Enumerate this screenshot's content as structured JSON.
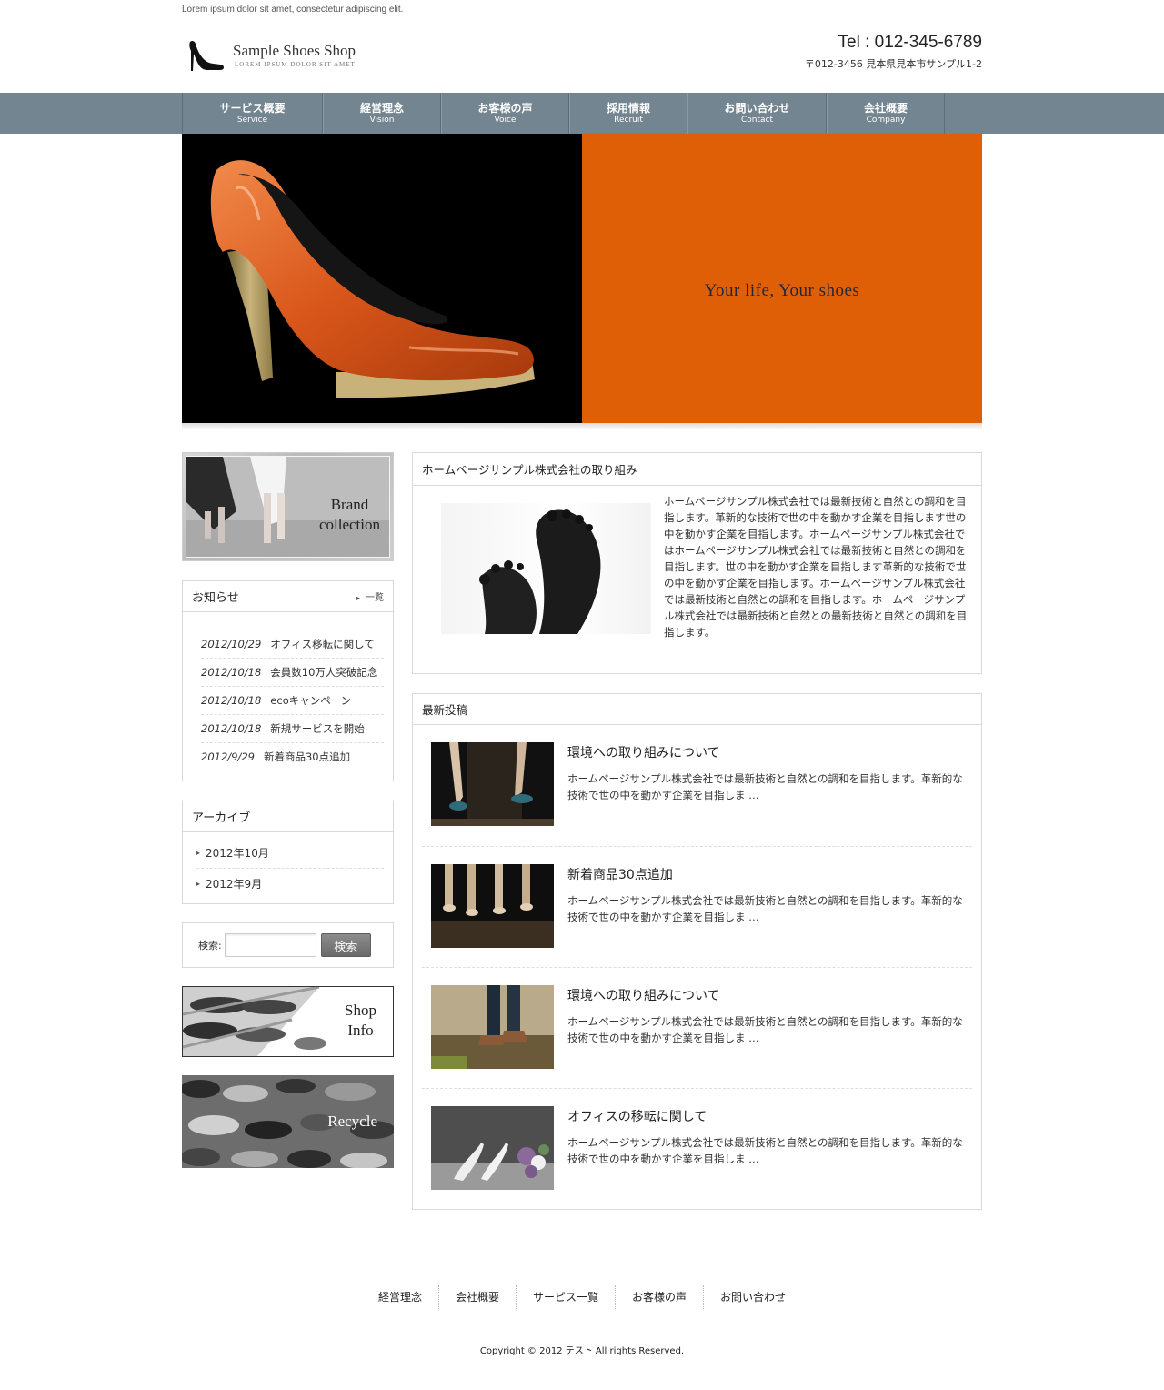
{
  "header": {
    "tagline": "Lorem ipsum dolor sit amet, consectetur adipiscing elit.",
    "logo_title": "Sample Shoes Shop",
    "logo_subtitle": "LOREM IPSUM DOLOR SIT AMET",
    "tel": "Tel : 012-345-6789",
    "address": "〒012-3456 見本県見本市サンプル1-2"
  },
  "nav": [
    {
      "jp": "サービス概要",
      "en": "Service"
    },
    {
      "jp": "経営理念",
      "en": "Vision"
    },
    {
      "jp": "お客様の声",
      "en": "Voice"
    },
    {
      "jp": "採用情報",
      "en": "Recruit"
    },
    {
      "jp": "お問い合わせ",
      "en": "Contact"
    },
    {
      "jp": "会社概要",
      "en": "Company"
    }
  ],
  "hero": {
    "slogan": "Your life, Your shoes",
    "accent_color": "#df5f06"
  },
  "sidebar": {
    "brand_banner": {
      "line1": "Brand",
      "line2": "collection"
    },
    "news": {
      "title": "お知らせ",
      "more_label": "一覧",
      "items": [
        {
          "date": "2012/10/29",
          "text": "オフィス移転に関して"
        },
        {
          "date": "2012/10/18",
          "text": "会員数10万人突破記念"
        },
        {
          "date": "2012/10/18",
          "text": "ecoキャンペーン"
        },
        {
          "date": "2012/10/18",
          "text": "新規サービスを開始"
        },
        {
          "date": "2012/9/29",
          "text": "新着商品30点追加"
        }
      ]
    },
    "archive": {
      "title": "アーカイブ",
      "items": [
        "2012年10月",
        "2012年9月"
      ]
    },
    "search": {
      "label": "検索:",
      "button": "検索",
      "value": ""
    },
    "shop_banner": {
      "line1": "Shop",
      "line2": "Info"
    },
    "recycle_banner": {
      "label": "Recycle"
    }
  },
  "main": {
    "intro": {
      "title": "ホームページサンプル株式会社の取り組み",
      "text": "ホームページサンプル株式会社では最新技術と自然との調和を目指します。革新的な技術で世の中を動かす企業を目指します世の中を動かす企業を目指します。ホームページサンプル株式会社ではホームページサンプル株式会社では最新技術と自然との調和を目指します。世の中を動かす企業を目指します革新的な技術で世の中を動かす企業を目指します。ホームページサンプル株式会社では最新技術と自然との調和を目指します。ホームページサンプル株式会社では最新技術と自然との最新技術と自然との調和を目指します。"
    },
    "latest": {
      "title": "最新投稿",
      "posts": [
        {
          "title": "環境への取り組みについて",
          "excerpt": "ホームページサンプル株式会社では最新技術と自然との調和を目指します。革新的な技術で世の中を動かす企業を目指しま …"
        },
        {
          "title": "新着商品30点追加",
          "excerpt": "ホームページサンプル株式会社では最新技術と自然との調和を目指します。革新的な技術で世の中を動かす企業を目指しま …"
        },
        {
          "title": "環境への取り組みについて",
          "excerpt": "ホームページサンプル株式会社では最新技術と自然との調和を目指します。革新的な技術で世の中を動かす企業を目指しま …"
        },
        {
          "title": "オフィスの移転に関して",
          "excerpt": "ホームページサンプル株式会社では最新技術と自然との調和を目指します。革新的な技術で世の中を動かす企業を目指しま …"
        }
      ]
    }
  },
  "footer": {
    "links": [
      "経営理念",
      "会社概要",
      "サービス一覧",
      "お客様の声",
      "お問い合わせ"
    ],
    "copyright": "Copyright © 2012 テスト All rights Reserved."
  },
  "colors": {
    "nav": "#738590",
    "hero_orange": "#df5f06"
  }
}
